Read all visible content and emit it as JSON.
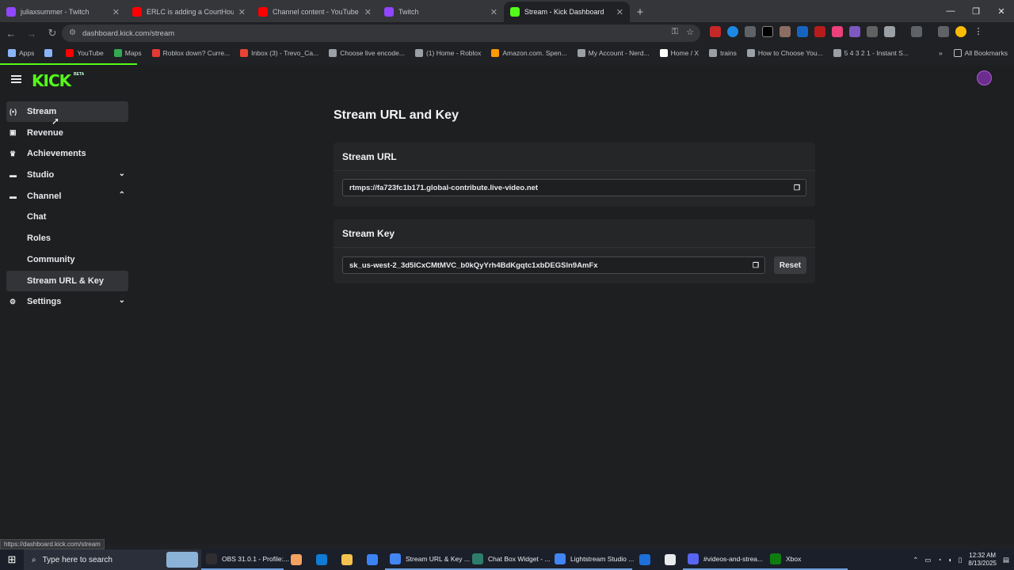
{
  "browser": {
    "tabs": [
      {
        "title": "juliaxsummer - Twitch",
        "color": "#9146ff",
        "active": false
      },
      {
        "title": "ERLC is adding a CourtHouse?",
        "color": "#ff0000",
        "active": false
      },
      {
        "title": "Channel content - YouTube Studio",
        "color": "#ff0000",
        "active": false
      },
      {
        "title": "Twitch",
        "color": "#9146ff",
        "active": false
      },
      {
        "title": "Stream - Kick Dashboard",
        "color": "#53fc18",
        "active": true
      }
    ],
    "url": "dashboard.kick.com/stream",
    "bookmarks": [
      {
        "label": "Apps",
        "color": "#8ab4f8"
      },
      {
        "label": "",
        "color": "#8ab4f8"
      },
      {
        "label": "YouTube",
        "color": "#ff0000"
      },
      {
        "label": "Maps",
        "color": "#34a853"
      },
      {
        "label": "Roblox down? Curre...",
        "color": "#e53935"
      },
      {
        "label": "Inbox (3) - Trevo_Ca...",
        "color": "#ea4335"
      },
      {
        "label": "Choose live encode...",
        "color": "#9aa0a6"
      },
      {
        "label": "(1) Home - Roblox",
        "color": "#9aa0a6"
      },
      {
        "label": "Amazon.com. Spen...",
        "color": "#ff9900"
      },
      {
        "label": "My Account - Nerd...",
        "color": "#9aa0a6"
      },
      {
        "label": "Home / X",
        "color": "#ffffff"
      },
      {
        "label": "trains",
        "color": "#9aa0a6"
      },
      {
        "label": "How to Choose You...",
        "color": "#9aa0a6"
      },
      {
        "label": "5 4 3 2 1 - Instant S...",
        "color": "#9aa0a6"
      }
    ],
    "all_bookmarks": "All Bookmarks",
    "status_url": "https://dashboard.kick.com/stream"
  },
  "kick": {
    "logo": "KICK",
    "beta": "BETA",
    "accent": "#53fc18",
    "sidebar": [
      {
        "label": "Stream",
        "icon": "stream-icon",
        "glyph": "(•)",
        "selected": true,
        "sub": false,
        "chevron": ""
      },
      {
        "label": "Revenue",
        "icon": "revenue-icon",
        "glyph": "▣",
        "selected": false,
        "sub": false,
        "chevron": ""
      },
      {
        "label": "Achievements",
        "icon": "trophy-icon",
        "glyph": "♛",
        "selected": false,
        "sub": false,
        "chevron": ""
      },
      {
        "label": "Studio",
        "icon": "studio-icon",
        "glyph": "▬",
        "selected": false,
        "sub": false,
        "chevron": "⌄"
      },
      {
        "label": "Channel",
        "icon": "channel-icon",
        "glyph": "▬",
        "selected": false,
        "sub": false,
        "chevron": "⌃"
      },
      {
        "label": "Chat",
        "icon": "",
        "glyph": "",
        "selected": false,
        "sub": true,
        "chevron": ""
      },
      {
        "label": "Roles",
        "icon": "",
        "glyph": "",
        "selected": false,
        "sub": true,
        "chevron": ""
      },
      {
        "label": "Community",
        "icon": "",
        "glyph": "",
        "selected": false,
        "sub": true,
        "chevron": ""
      },
      {
        "label": "Stream URL & Key",
        "icon": "",
        "glyph": "",
        "selected": true,
        "sub": true,
        "chevron": ""
      },
      {
        "label": "Settings",
        "icon": "gear-icon",
        "glyph": "⚙",
        "selected": false,
        "sub": false,
        "chevron": "⌄"
      }
    ],
    "page_title": "Stream URL and Key",
    "stream_url": {
      "heading": "Stream URL",
      "value": "rtmps://fa723fc1b171.global-contribute.live-video.net"
    },
    "stream_key": {
      "heading": "Stream Key",
      "value": "sk_us-west-2_3d5lCxCMtMVC_b0kQyYrh4BdKgqtc1xbDEGSln9AmFx",
      "reset_label": "Reset"
    }
  },
  "taskbar": {
    "search_placeholder": "Type here to search",
    "apps": [
      {
        "label": "OBS 31.0.1 - Profile:...",
        "color": "#302e31",
        "type": "app"
      },
      {
        "label": "",
        "color": "#f4a261",
        "type": "icon"
      },
      {
        "label": "",
        "color": "#0f7bd4",
        "type": "icon"
      },
      {
        "label": "",
        "color": "#f2c14e",
        "type": "icon"
      },
      {
        "label": "",
        "color": "#3b82f6",
        "type": "icon"
      },
      {
        "label": "Stream URL & Key ...",
        "color": "#4285f4",
        "type": "app"
      },
      {
        "label": "Chat Box Widget - ...",
        "color": "#2e7d6b",
        "type": "app"
      },
      {
        "label": "Lightstream Studio ...",
        "color": "#4285f4",
        "type": "app"
      },
      {
        "label": "",
        "color": "#1e6fd9",
        "type": "icon"
      },
      {
        "label": "",
        "color": "#e8eaed",
        "type": "icon"
      },
      {
        "label": "#videos-and-strea...",
        "color": "#5865f2",
        "type": "app"
      },
      {
        "label": "Xbox",
        "color": "#107c10",
        "type": "app"
      }
    ],
    "time": "12:32 AM",
    "date": "8/13/2025"
  }
}
